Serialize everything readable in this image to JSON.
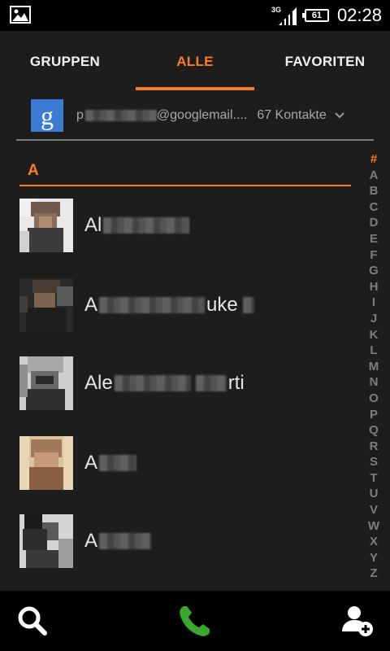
{
  "status_bar": {
    "network_type": "3G",
    "battery": "61",
    "time": "02:28"
  },
  "tabs": [
    {
      "label": "GRUPPEN",
      "active": false
    },
    {
      "label": "ALLE",
      "active": true
    },
    {
      "label": "FAVORITEN",
      "active": false
    }
  ],
  "account": {
    "logo_letter": "g",
    "email": "p████████@googlemail....",
    "email_prefix": "p",
    "email_suffix": "@googlemail....",
    "count": "67 Kontakte"
  },
  "section": {
    "letter": "A"
  },
  "contacts": [
    {
      "prefix": "Al",
      "suffix": ""
    },
    {
      "prefix": "A",
      "suffix": "uke"
    },
    {
      "prefix": "Ale",
      "suffix": "rti"
    },
    {
      "prefix": "A",
      "suffix": ""
    },
    {
      "prefix": "A",
      "suffix": ""
    }
  ],
  "index_letters": [
    "#",
    "A",
    "B",
    "C",
    "D",
    "E",
    "F",
    "G",
    "H",
    "I",
    "J",
    "K",
    "L",
    "M",
    "N",
    "O",
    "P",
    "Q",
    "R",
    "S",
    "T",
    "U",
    "V",
    "W",
    "X",
    "Y",
    "Z"
  ],
  "colors": {
    "accent": "#ff7a1a",
    "call_green": "#3aa82f",
    "background": "#1d1d1d"
  },
  "icons": {
    "gallery": "image-icon",
    "signal": "signal-icon",
    "battery": "battery-icon",
    "search": "search-icon",
    "call": "phone-icon",
    "add_contact": "add-contact-icon",
    "chevron": "chevron-down-icon"
  }
}
